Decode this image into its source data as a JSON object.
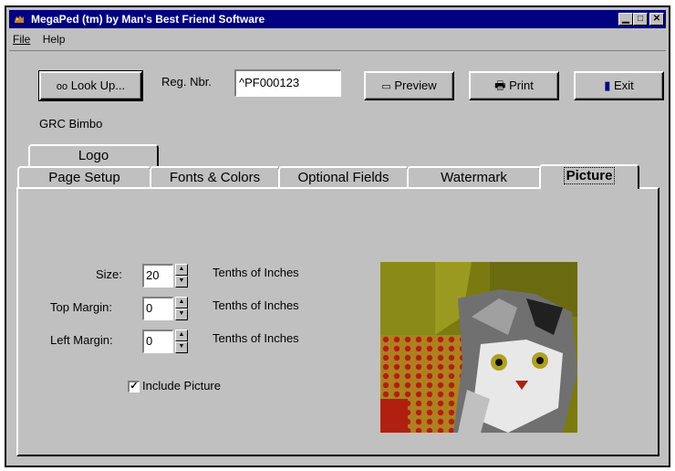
{
  "window": {
    "title": "MegaPed (tm) by Man's Best Friend Software"
  },
  "menu": {
    "file_label": "File",
    "help_label": "Help"
  },
  "toolbar": {
    "lookup_label": "Look Up...",
    "reg_label": "Reg. Nbr.",
    "reg_value": "^PF000123",
    "preview_label": "Preview",
    "print_label": "Print",
    "exit_label": "Exit",
    "dog_name": "GRC Bimbo"
  },
  "tabs": {
    "row_back": [
      "Logo"
    ],
    "row_front": [
      "Page Setup",
      "Fonts & Colors",
      "Optional Fields",
      "Watermark",
      "Picture"
    ],
    "active": "Picture"
  },
  "picture_tab": {
    "size_label": "Size:",
    "size_value": "20",
    "size_unit": "Tenths of Inches",
    "top_label": "Top Margin:",
    "top_value": "0",
    "top_unit": "Tenths of Inches",
    "left_label": "Left Margin:",
    "left_value": "0",
    "left_unit": "Tenths of Inches",
    "include_label": "Include Picture",
    "include_checked": true
  }
}
